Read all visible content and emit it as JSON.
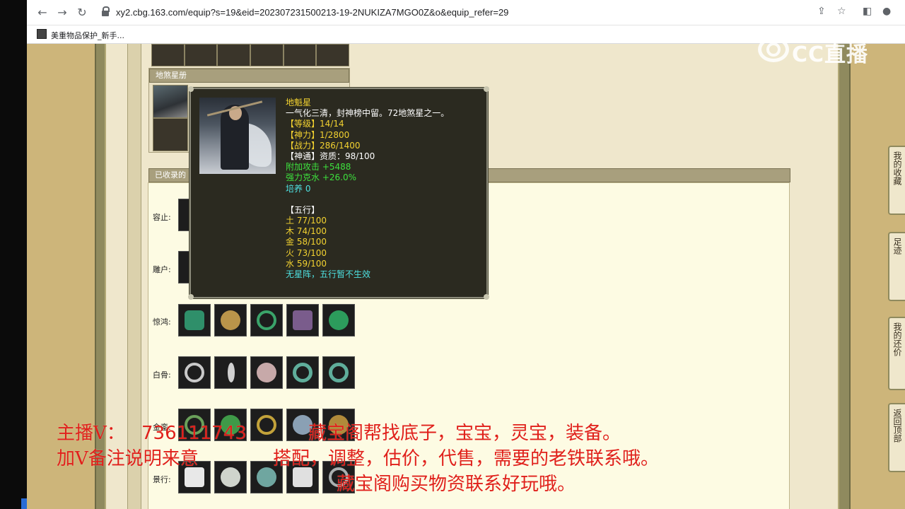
{
  "browser": {
    "url": "xy2.cbg.163.com/equip?s=19&eid=202307231500213-19-2NUKIZA7MGO0Z&o&equip_refer=29",
    "bookmark_label": "美重物品保护_新手..."
  },
  "sections": {
    "star_book_title": "地煞星册",
    "collected_title": "已收录的"
  },
  "rows": [
    {
      "label": "容止:"
    },
    {
      "label": "雕户:"
    },
    {
      "label": "惊鸿:"
    },
    {
      "label": "白骨:"
    },
    {
      "label": "金銮:"
    },
    {
      "label": "景行:"
    }
  ],
  "side_tabs": [
    "我的收藏",
    "足迹",
    "我的还价",
    "返回顶部"
  ],
  "tooltip": {
    "name": "地魁星",
    "desc": "一气化三清，封神榜中留。72地煞星之一。",
    "level": "【等级】14/14",
    "divine": "【神力】1/2800",
    "combat": "【战力】286/1400",
    "talent": "【神通】资质：98/100",
    "bonus_attack": "附加攻击 +5488",
    "counter": "强力克水 +26.0%",
    "cultivate": "培养 0",
    "five_title": "【五行】",
    "earth": "土 77/100",
    "wood": "木 74/100",
    "metal": "金 58/100",
    "fire": "火 73/100",
    "water": "水 59/100",
    "note": "无星阵，五行暂不生效"
  },
  "logo": {
    "text": "CC直播"
  },
  "overlay": {
    "line1_left": "主播V：",
    "line1_num": "736111743",
    "line1_right": "藏宝阁帮找底子，宝宝，灵宝，装备。",
    "line2_left": "加V备注说明来意",
    "line2_right": "搭配，调整，估价，代售，需要的老铁联系哦。",
    "line3": "藏宝阁购买物资联系好玩哦。"
  },
  "colors": {
    "tooltip_bg": "#2b2a20",
    "tooltip_yellow": "#f3d230",
    "tooltip_green": "#3de03d",
    "tooltip_cyan": "#4ee0e0",
    "overlay_red": "#e0201a"
  }
}
